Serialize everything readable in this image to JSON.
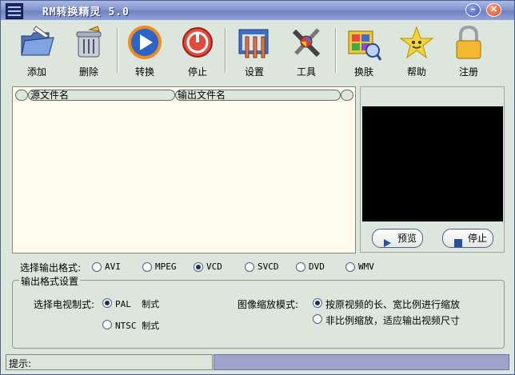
{
  "window": {
    "title": "RM转换精灵 5.0",
    "app_icon_name": "app-icon"
  },
  "toolbar": {
    "add": "添加",
    "delete": "删除",
    "convert": "转换",
    "stop": "停止",
    "settings": "设置",
    "tools": "工具",
    "skin": "换肤",
    "help": "帮助",
    "register": "注册"
  },
  "file_list": {
    "col_source": "源文件名",
    "col_output": "输出文件名"
  },
  "preview": {
    "preview_button": "预览",
    "stop_button": "停止"
  },
  "output_format": {
    "label": "选择输出格式:",
    "options": [
      "AVI",
      "MPEG",
      "VCD",
      "SVCD",
      "DVD",
      "WMV"
    ],
    "selected": "VCD"
  },
  "settings_group": {
    "title": "输出格式设置",
    "tv_system_label": "选择电视制式:",
    "tv_options": [
      "PAL  制式",
      "NTSC 制式"
    ],
    "tv_selected": "PAL  制式",
    "scale_label": "图像缩放模式:",
    "scale_options": [
      "按原视频的长、宽比例进行缩放",
      "非比例缩放，适应输出视频尺寸"
    ],
    "scale_selected": "按原视频的长、宽比例进行缩放"
  },
  "status": {
    "hint_label": "提示:"
  },
  "colors": {
    "background": "#dde6dc",
    "list_background": "#fffced",
    "title_bar": "#7f92cc",
    "status_panel": "#9fa3cc"
  }
}
